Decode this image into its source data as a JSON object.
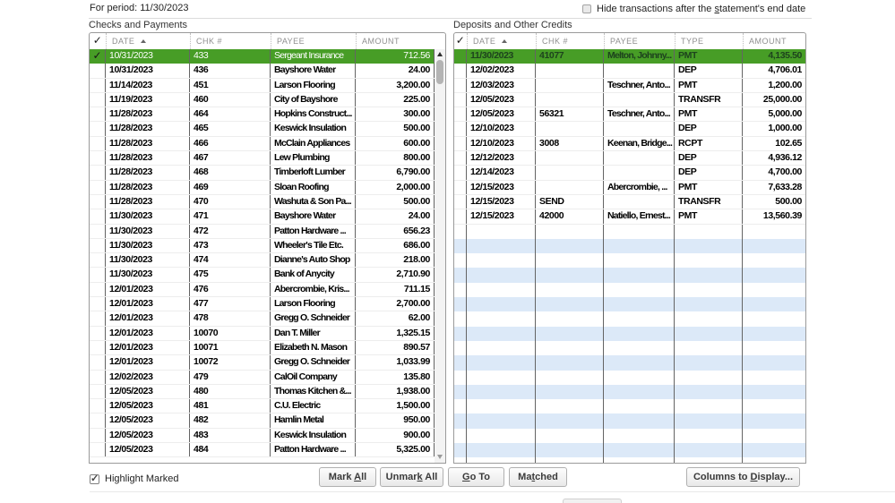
{
  "header": {
    "period_label": "For period: 11/30/2023",
    "hide_checkbox": {
      "pre": "Hide transactions after the ",
      "key": "s",
      "post": "tatement's end date"
    }
  },
  "left_panel": {
    "title": "Checks and Payments",
    "col_headers": {
      "check": "✓",
      "date": "DATE",
      "chk": "CHK #",
      "payee": "PAYEE",
      "amount": "AMOUNT"
    },
    "rows": [
      {
        "date": "10/31/2023",
        "chk": "433",
        "payee": "Sergeant Insurance",
        "amount": "712.56",
        "selected": true,
        "checked": true
      },
      {
        "date": "10/31/2023",
        "chk": "436",
        "payee": "Bayshore Water",
        "amount": "24.00"
      },
      {
        "date": "11/14/2023",
        "chk": "451",
        "payee": "Larson Flooring",
        "amount": "3,200.00"
      },
      {
        "date": "11/19/2023",
        "chk": "460",
        "payee": "City of Bayshore",
        "amount": "225.00"
      },
      {
        "date": "11/28/2023",
        "chk": "464",
        "payee": "Hopkins Construct...",
        "amount": "300.00"
      },
      {
        "date": "11/28/2023",
        "chk": "465",
        "payee": "Keswick Insulation",
        "amount": "500.00"
      },
      {
        "date": "11/28/2023",
        "chk": "466",
        "payee": "McClain Appliances",
        "amount": "600.00"
      },
      {
        "date": "11/28/2023",
        "chk": "467",
        "payee": "Lew Plumbing",
        "amount": "800.00"
      },
      {
        "date": "11/28/2023",
        "chk": "468",
        "payee": "Timberloft Lumber",
        "amount": "6,790.00"
      },
      {
        "date": "11/28/2023",
        "chk": "469",
        "payee": "Sloan Roofing",
        "amount": "2,000.00"
      },
      {
        "date": "11/28/2023",
        "chk": "470",
        "payee": "Washuta & Son Pa...",
        "amount": "500.00"
      },
      {
        "date": "11/30/2023",
        "chk": "471",
        "payee": "Bayshore Water",
        "amount": "24.00"
      },
      {
        "date": "11/30/2023",
        "chk": "472",
        "payee": "Patton Hardware ...",
        "amount": "656.23"
      },
      {
        "date": "11/30/2023",
        "chk": "473",
        "payee": "Wheeler's Tile Etc.",
        "amount": "686.00"
      },
      {
        "date": "11/30/2023",
        "chk": "474",
        "payee": "Dianne's Auto Shop",
        "amount": "218.00"
      },
      {
        "date": "11/30/2023",
        "chk": "475",
        "payee": "Bank of Anycity",
        "amount": "2,710.90"
      },
      {
        "date": "12/01/2023",
        "chk": "476",
        "payee": "Abercrombie, Kris...",
        "amount": "711.15"
      },
      {
        "date": "12/01/2023",
        "chk": "477",
        "payee": "Larson Flooring",
        "amount": "2,700.00"
      },
      {
        "date": "12/01/2023",
        "chk": "478",
        "payee": "Gregg O. Schneider",
        "amount": "62.00"
      },
      {
        "date": "12/01/2023",
        "chk": "10070",
        "payee": "Dan T. Miller",
        "amount": "1,325.15"
      },
      {
        "date": "12/01/2023",
        "chk": "10071",
        "payee": "Elizabeth N. Mason",
        "amount": "890.57"
      },
      {
        "date": "12/01/2023",
        "chk": "10072",
        "payee": "Gregg O. Schneider",
        "amount": "1,033.99"
      },
      {
        "date": "12/02/2023",
        "chk": "479",
        "payee": "CalOil Company",
        "amount": "135.80"
      },
      {
        "date": "12/05/2023",
        "chk": "480",
        "payee": "Thomas Kitchen &...",
        "amount": "1,938.00"
      },
      {
        "date": "12/05/2023",
        "chk": "481",
        "payee": "C.U. Electric",
        "amount": "1,500.00"
      },
      {
        "date": "12/05/2023",
        "chk": "482",
        "payee": "Hamlin Metal",
        "amount": "950.00"
      },
      {
        "date": "12/05/2023",
        "chk": "483",
        "payee": "Keswick Insulation",
        "amount": "900.00"
      },
      {
        "date": "12/05/2023",
        "chk": "484",
        "payee": "Patton Hardware ...",
        "amount": "5,325.00"
      }
    ]
  },
  "right_panel": {
    "title": "Deposits and Other Credits",
    "col_headers": {
      "check": "✓",
      "date": "DATE",
      "chk": "CHK #",
      "payee": "PAYEE",
      "type": "TYPE",
      "amount": "AMOUNT"
    },
    "rows": [
      {
        "date": "11/30/2023",
        "chk": "41077",
        "payee": "Melton, Johnny...",
        "type": "PMT",
        "amount": "4,135.50",
        "selected": true
      },
      {
        "date": "12/02/2023",
        "chk": "",
        "payee": "",
        "type": "DEP",
        "amount": "4,706.01"
      },
      {
        "date": "12/03/2023",
        "chk": "",
        "payee": "Teschner, Anto...",
        "type": "PMT",
        "amount": "1,200.00"
      },
      {
        "date": "12/05/2023",
        "chk": "",
        "payee": "",
        "type": "TRANSFR",
        "amount": "25,000.00"
      },
      {
        "date": "12/05/2023",
        "chk": "56321",
        "payee": "Teschner, Anto...",
        "type": "PMT",
        "amount": "5,000.00"
      },
      {
        "date": "12/10/2023",
        "chk": "",
        "payee": "",
        "type": "DEP",
        "amount": "1,000.00"
      },
      {
        "date": "12/10/2023",
        "chk": "3008",
        "payee": "Keenan, Bridge...",
        "type": "RCPT",
        "amount": "102.65"
      },
      {
        "date": "12/12/2023",
        "chk": "",
        "payee": "",
        "type": "DEP",
        "amount": "4,936.12"
      },
      {
        "date": "12/14/2023",
        "chk": "",
        "payee": "",
        "type": "DEP",
        "amount": "4,700.00"
      },
      {
        "date": "12/15/2023",
        "chk": "",
        "payee": "Abercrombie, ...",
        "type": "PMT",
        "amount": "7,633.28"
      },
      {
        "date": "12/15/2023",
        "chk": "SEND",
        "payee": "",
        "type": "TRANSFR",
        "amount": "500.00"
      },
      {
        "date": "12/15/2023",
        "chk": "42000",
        "payee": "Natiello, Ernest...",
        "type": "PMT",
        "amount": "13,560.39"
      }
    ],
    "empty_row_count": 17
  },
  "footer": {
    "highlight_checkbox_label": "Highlight Marked",
    "buttons": [
      {
        "name": "mark-all",
        "pre": "Mark ",
        "key": "A",
        "post": "ll"
      },
      {
        "name": "unmark-all",
        "pre": "Unmar",
        "key": "k",
        "post": " All"
      },
      {
        "name": "go-to",
        "pre": "",
        "key": "G",
        "post": "o To"
      },
      {
        "name": "matched",
        "pre": "Ma",
        "key": "t",
        "post": "ched"
      },
      {
        "name": "columns-to-display",
        "pre": "Columns to ",
        "key": "D",
        "post": "isplay..."
      }
    ]
  },
  "colors": {
    "selected_green": "#479d26",
    "stripe_blue": "#dce9f8"
  }
}
